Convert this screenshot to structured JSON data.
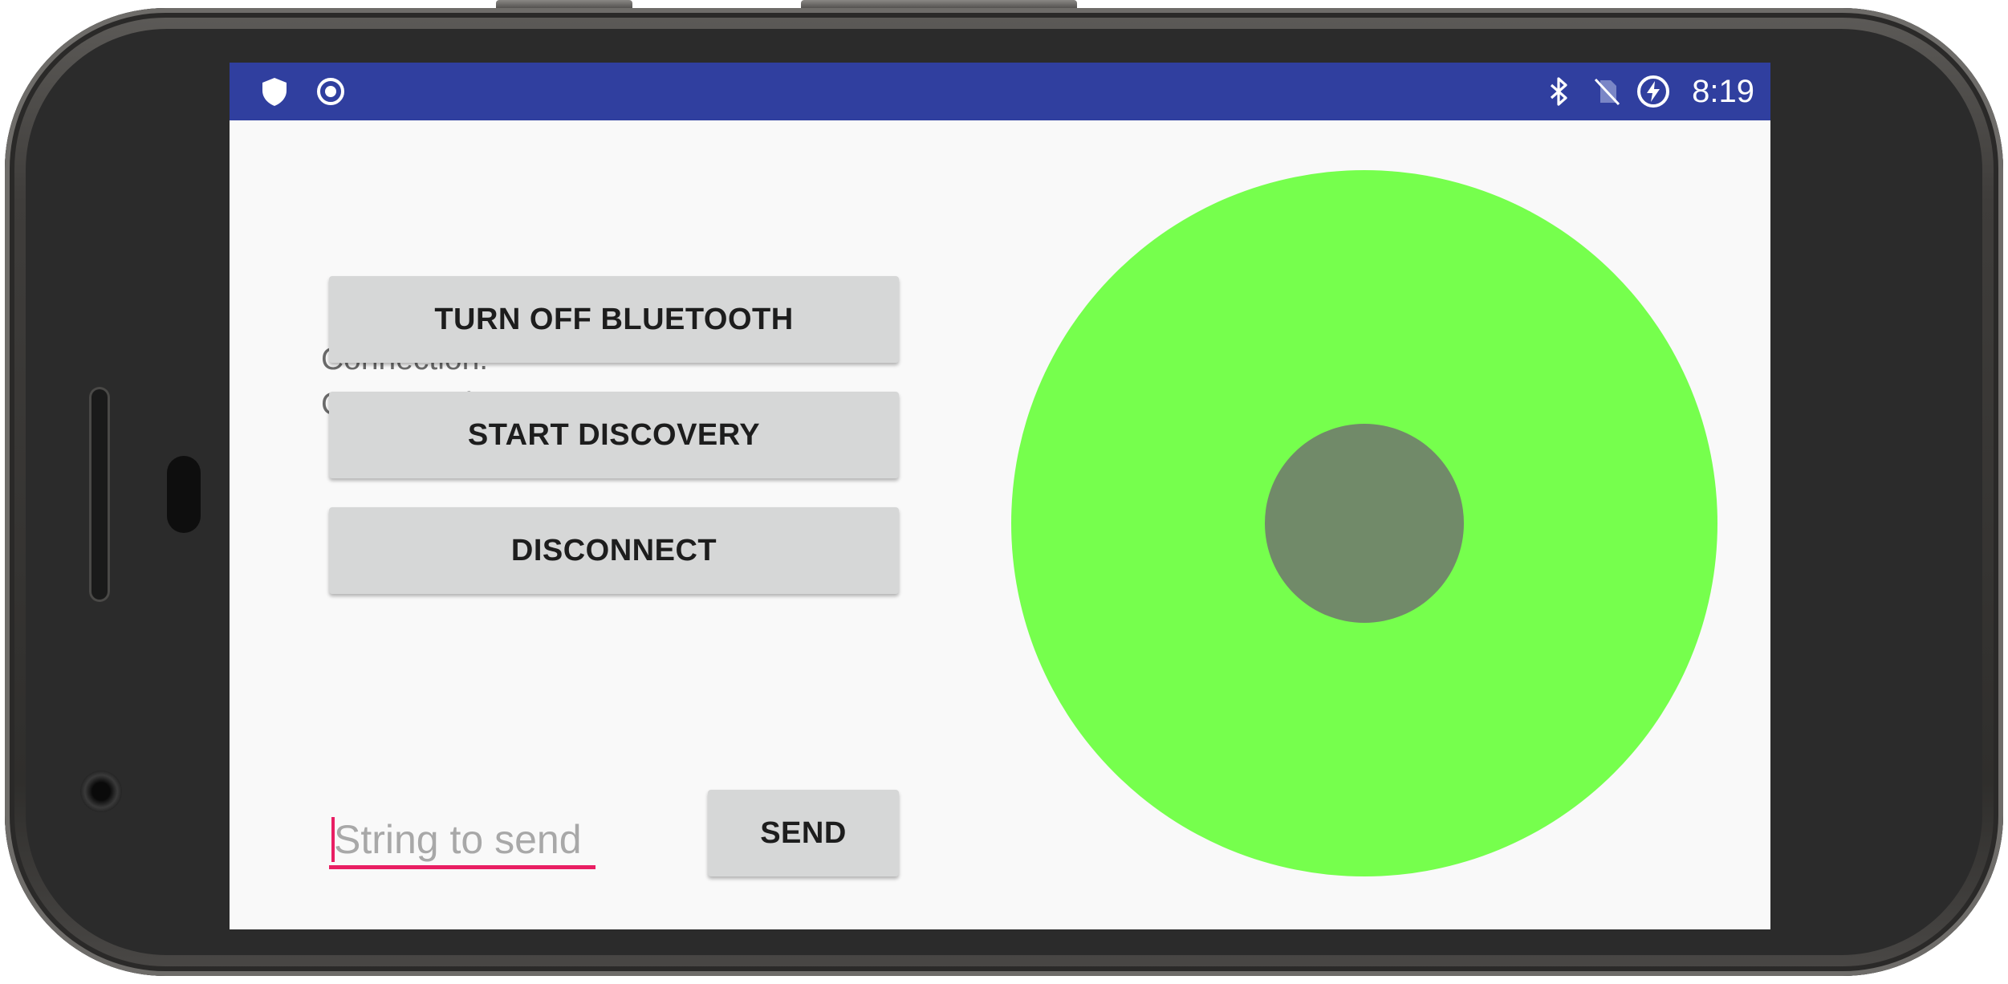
{
  "status_bar": {
    "time": "8:19",
    "background_color": "#303f9f",
    "left_icons": [
      "shield-icon",
      "record-icon"
    ],
    "right_icons": [
      "bluetooth-icon",
      "no-sim-icon",
      "battery-saver-icon"
    ]
  },
  "connection": {
    "label": "Connection:",
    "status": "Connected"
  },
  "buttons": {
    "bluetooth": "TURN OFF BLUETOOTH",
    "discovery": "START DISCOVERY",
    "disconnect": "DISCONNECT",
    "send": "SEND"
  },
  "send_input": {
    "placeholder": "String to send",
    "value": "",
    "accent_color": "#e91e63"
  },
  "joystick": {
    "base_color": "#76ff4d",
    "knob_color": "#718a69"
  }
}
